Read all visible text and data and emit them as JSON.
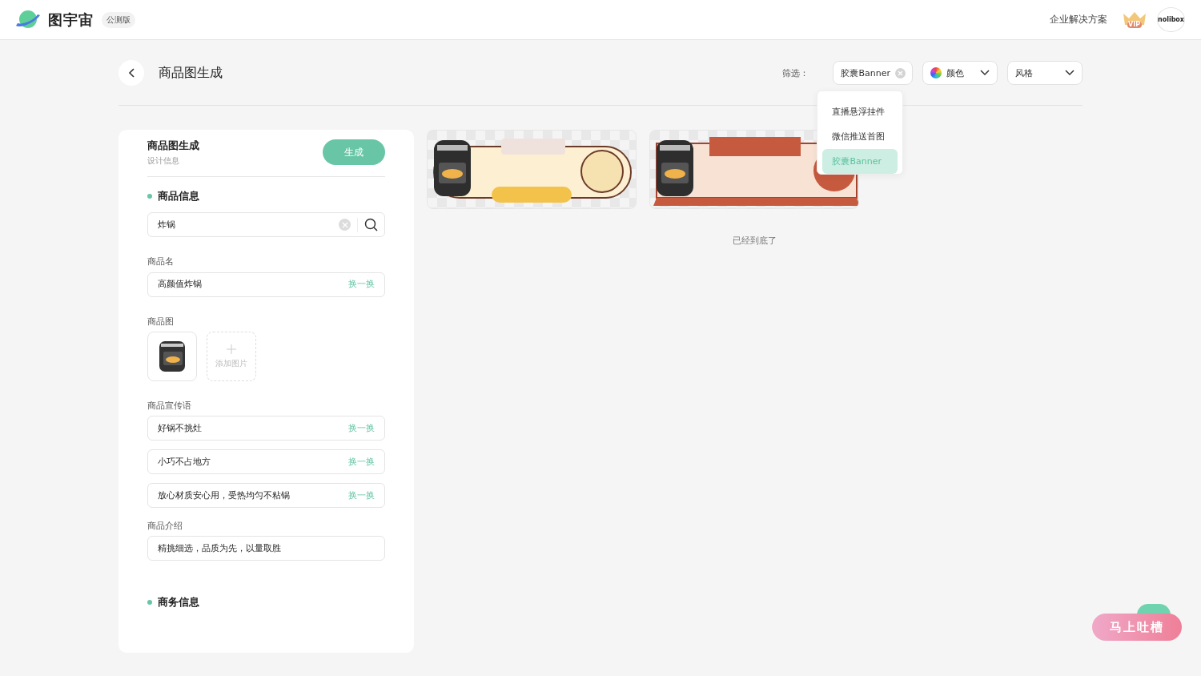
{
  "header": {
    "logo_text": "图宇宙",
    "badge": "公测版",
    "link": "企业解决方案",
    "vip_label": "VIP",
    "avatar_text": "nolibox"
  },
  "page": {
    "title": "商品图生成"
  },
  "filters": {
    "label": "筛选：",
    "chips": [
      {
        "kind": "clearable",
        "label": "胶囊Banner"
      },
      {
        "kind": "color",
        "label": "颜色"
      },
      {
        "kind": "select",
        "label": "风格"
      }
    ],
    "menu": {
      "open": true,
      "items": [
        {
          "label": "直播悬浮挂件",
          "selected": false
        },
        {
          "label": "微信推送首图",
          "selected": false
        },
        {
          "label": "胶囊Banner",
          "selected": true
        }
      ]
    }
  },
  "form": {
    "title": "商品图生成",
    "subtitle": "设计信息",
    "generate_button": "生成",
    "product_heading": "商品信息",
    "search_value": "炸锅",
    "name_label": "商品名",
    "name_field": {
      "value": "高颜值炸锅",
      "action": "换一换"
    },
    "image_label": "商品图",
    "add_image_label": "添加图片",
    "slogan_label": "商品宣传语",
    "slogans": [
      {
        "value": "好锅不挑灶",
        "action": "换一换"
      },
      {
        "value": "小巧不占地方",
        "action": "换一换"
      },
      {
        "value": "放心材质安心用，受热均匀不粘锅",
        "action": "换一换"
      }
    ],
    "intro_label": "商品介绍",
    "intro_value": "精挑细选，品质为先，以量取胜",
    "business_heading": "商务信息"
  },
  "results": {
    "cards": [
      {
        "kind": "capsule"
      },
      {
        "kind": "ribbon"
      }
    ],
    "end_text": "已经到底了"
  },
  "feedback": {
    "label": "马上吐槽"
  }
}
